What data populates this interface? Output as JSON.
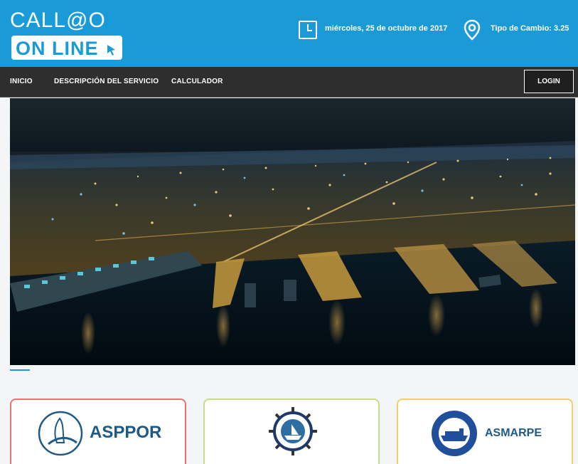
{
  "header": {
    "logo": {
      "line1": "CALL@O",
      "line2": "ON LINE"
    },
    "date": "miércoles, 25 de octubre de 2017",
    "exchange_rate": "Tipo de Cambio: 3.25",
    "icons": {
      "date": "calendar-clock-icon",
      "location": "location-pin-icon"
    }
  },
  "nav": {
    "items": [
      {
        "label": "INICIO"
      },
      {
        "label": "DESCRIPCIÓN DEL SERVICIO"
      },
      {
        "label": "CALCULADOR"
      }
    ],
    "login": "LOGIN"
  },
  "partners": [
    {
      "name": "ASPPOR",
      "icon": "ship-prow-icon"
    },
    {
      "name": "",
      "icon": "ship-wheel-seal-icon"
    },
    {
      "name": "ASMARPE",
      "icon": "cargo-ship-seal-icon"
    }
  ],
  "colors": {
    "brand": "#1a9ad6",
    "nav_bg": "#2e2e2e",
    "accent_card_1": "#e8746f",
    "accent_card_2": "#c7d98a",
    "accent_card_3": "#f2cf6a"
  }
}
